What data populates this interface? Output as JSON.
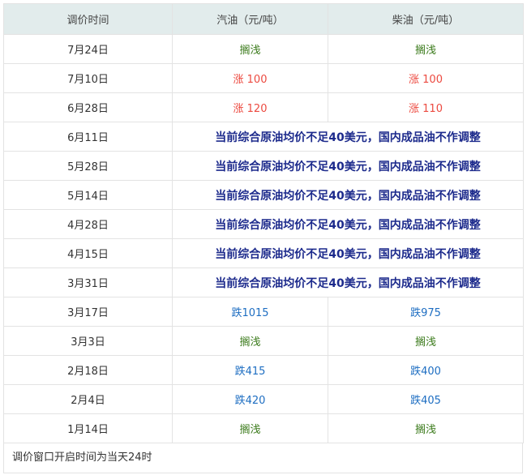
{
  "header": {
    "date": "调价时间",
    "gasoline": "汽油（元/吨）",
    "diesel": "柴油（元/吨）"
  },
  "rows": [
    {
      "date": "7月24日",
      "type": "split",
      "gas": "搁浅",
      "gas_class": "stay",
      "diesel": "搁浅",
      "diesel_class": "stay"
    },
    {
      "date": "7月10日",
      "type": "split",
      "gas": "涨 100",
      "gas_class": "up",
      "diesel": "涨 100",
      "diesel_class": "up"
    },
    {
      "date": "6月28日",
      "type": "split",
      "gas": "涨 120",
      "gas_class": "up",
      "diesel": "涨 110",
      "diesel_class": "up"
    },
    {
      "date": "6月11日",
      "type": "merged",
      "text": "当前综合原油均价不足40美元，国内成品油不作调整"
    },
    {
      "date": "5月28日",
      "type": "merged",
      "text": "当前综合原油均价不足40美元，国内成品油不作调整"
    },
    {
      "date": "5月14日",
      "type": "merged",
      "text": "当前综合原油均价不足40美元，国内成品油不作调整"
    },
    {
      "date": "4月28日",
      "type": "merged",
      "text": "当前综合原油均价不足40美元，国内成品油不作调整"
    },
    {
      "date": "4月15日",
      "type": "merged",
      "text": "当前综合原油均价不足40美元，国内成品油不作调整"
    },
    {
      "date": "3月31日",
      "type": "merged",
      "text": "当前综合原油均价不足40美元，国内成品油不作调整"
    },
    {
      "date": "3月17日",
      "type": "split",
      "gas": "跌1015",
      "gas_class": "down",
      "diesel": "跌975",
      "diesel_class": "down"
    },
    {
      "date": "3月3日",
      "type": "split",
      "gas": "搁浅",
      "gas_class": "stay",
      "diesel": "搁浅",
      "diesel_class": "stay"
    },
    {
      "date": "2月18日",
      "type": "split",
      "gas": "跌415",
      "gas_class": "down",
      "diesel": "跌400",
      "diesel_class": "down"
    },
    {
      "date": "2月4日",
      "type": "split",
      "gas": "跌420",
      "gas_class": "down",
      "diesel": "跌405",
      "diesel_class": "down"
    },
    {
      "date": "1月14日",
      "type": "split",
      "gas": "搁浅",
      "gas_class": "stay",
      "diesel": "搁浅",
      "diesel_class": "stay"
    }
  ],
  "footer": "调价窗口开启时间为当天24时",
  "colors": {
    "header_bg": "#e2ecec",
    "stay": "#3a7a1a",
    "up": "#ec4a40",
    "down": "#1e6ec2",
    "notice": "#1c2a8c"
  }
}
